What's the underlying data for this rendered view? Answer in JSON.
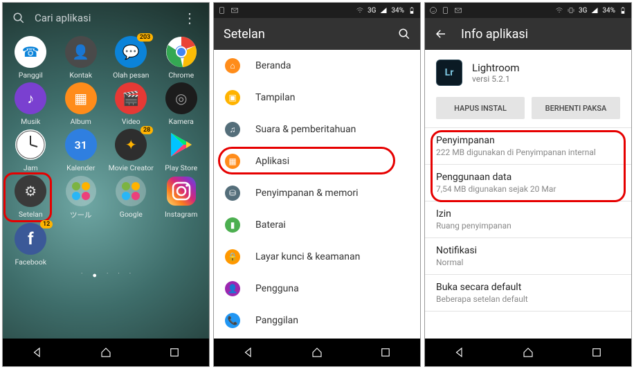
{
  "phone1": {
    "search_placeholder": "Cari aplikasi",
    "apps": [
      {
        "label": "Panggil",
        "name": "phone-icon",
        "bg": "#ffffff",
        "fg": "#0b83d9",
        "badge": null,
        "glyph": "☎"
      },
      {
        "label": "Kontak",
        "name": "contacts-icon",
        "bg": "#4a4a4a",
        "fg": "#fff",
        "badge": null,
        "glyph": "👤"
      },
      {
        "label": "Olah pesan",
        "name": "messaging-icon",
        "bg": "#0b83d9",
        "fg": "#fff",
        "badge": "203",
        "glyph": "💬"
      },
      {
        "label": "Chrome",
        "name": "chrome-icon",
        "bg": "",
        "fg": "",
        "badge": null,
        "glyph": "chrome"
      },
      {
        "label": "Musik",
        "name": "music-icon",
        "bg": "#7a40d0",
        "fg": "#fff",
        "badge": null,
        "glyph": "♪"
      },
      {
        "label": "Album",
        "name": "album-icon",
        "bg": "#ff8c1a",
        "fg": "#fff",
        "badge": null,
        "glyph": "▦"
      },
      {
        "label": "Video",
        "name": "video-icon",
        "bg": "#e53935",
        "fg": "#fff",
        "badge": null,
        "glyph": "🎬"
      },
      {
        "label": "Kamera",
        "name": "camera-icon",
        "bg": "#1c1c1c",
        "fg": "#9e9e9e",
        "badge": null,
        "glyph": "◎"
      },
      {
        "label": "Jam",
        "name": "clock-icon",
        "bg": "#ffffff",
        "fg": "#333",
        "badge": null,
        "glyph": "clock"
      },
      {
        "label": "Kalender",
        "name": "calendar-icon",
        "bg": "#2f7fe0",
        "fg": "#fff",
        "badge": null,
        "glyph": "31"
      },
      {
        "label": "Movie Creator",
        "name": "movie-creator-icon",
        "bg": "#2e2e2e",
        "fg": "#ffb300",
        "badge": "28",
        "glyph": "✦"
      },
      {
        "label": "Play Store",
        "name": "play-store-icon",
        "bg": "",
        "fg": "",
        "badge": null,
        "glyph": "play"
      },
      {
        "label": "Setelan",
        "name": "settings-icon",
        "bg": "#3a3a3a",
        "fg": "#e0e0e0",
        "badge": null,
        "glyph": "⚙"
      },
      {
        "label": "ツール",
        "name": "tools-folder-icon",
        "bg": "rgba(255,255,255,0.25)",
        "fg": "#fff",
        "badge": null,
        "glyph": "folder"
      },
      {
        "label": "Google",
        "name": "google-folder-icon",
        "bg": "rgba(255,255,255,0.25)",
        "fg": "#fff",
        "badge": null,
        "glyph": "folder"
      },
      {
        "label": "Instagram",
        "name": "instagram-icon",
        "bg": "linear-gradient(45deg,#feda75,#fa7e1e,#d62976,#962fbf,#4f5bd5)",
        "fg": "#fff",
        "badge": null,
        "glyph": "ig"
      },
      {
        "label": "Facebook",
        "name": "facebook-icon",
        "bg": "#3b5998",
        "fg": "#fff",
        "badge": "12",
        "glyph": "f"
      }
    ],
    "highlight_index": 12
  },
  "phone2": {
    "status": {
      "network": "3G",
      "signal": "▮",
      "battery": "34%"
    },
    "title": "Setelan",
    "rows": [
      {
        "name": "home-row",
        "icon_bg": "#ff8c1a",
        "label": "Beranda",
        "glyph": "⌂"
      },
      {
        "name": "display-row",
        "icon_bg": "#ffb300",
        "label": "Tampilan",
        "glyph": "▣"
      },
      {
        "name": "sound-row",
        "icon_bg": "#546e7a",
        "label": "Suara & pemberitahuan",
        "glyph": "♫"
      },
      {
        "name": "apps-row",
        "icon_bg": "#ff8c1a",
        "label": "Aplikasi",
        "glyph": "▦"
      },
      {
        "name": "storage-row",
        "icon_bg": "#546e7a",
        "label": "Penyimpanan & memori",
        "glyph": "⛁"
      },
      {
        "name": "battery-row",
        "icon_bg": "#4caf50",
        "label": "Baterai",
        "glyph": "▮"
      },
      {
        "name": "lock-row",
        "icon_bg": "#ff9800",
        "label": "Layar kunci & keamanan",
        "glyph": "🔒"
      },
      {
        "name": "users-row",
        "icon_bg": "#9c27b0",
        "label": "Pengguna",
        "glyph": "👤"
      },
      {
        "name": "call-row",
        "icon_bg": "#2196f3",
        "label": "Panggilan",
        "glyph": "📞"
      }
    ],
    "highlight_index": 3
  },
  "phone3": {
    "status": {
      "network": "3G",
      "battery": "34%"
    },
    "title": "Info aplikasi",
    "app": {
      "name": "Lightroom",
      "version": "versi 5.2.1",
      "icon_label": "Lr"
    },
    "buttons": {
      "uninstall": "HAPUS INSTAL",
      "forcestop": "BERHENTI PAKSA"
    },
    "rows": [
      {
        "name": "storage-row",
        "title": "Penyimpanan",
        "sub": "222 MB digunakan di Penyimpanan internal",
        "highlight": true
      },
      {
        "name": "data-usage-row",
        "title": "Penggunaan data",
        "sub": "7,54 MB digunakan sejak 20 Mar",
        "highlight": true
      },
      {
        "name": "permissions-row",
        "title": "Izin",
        "sub": "Ruang penyimpanan",
        "highlight": false
      },
      {
        "name": "notifications-row",
        "title": "Notifikasi",
        "sub": "Normal",
        "highlight": false
      },
      {
        "name": "open-default-row",
        "title": "Buka secara default",
        "sub": "Beberapa setelan default",
        "highlight": false
      }
    ]
  }
}
